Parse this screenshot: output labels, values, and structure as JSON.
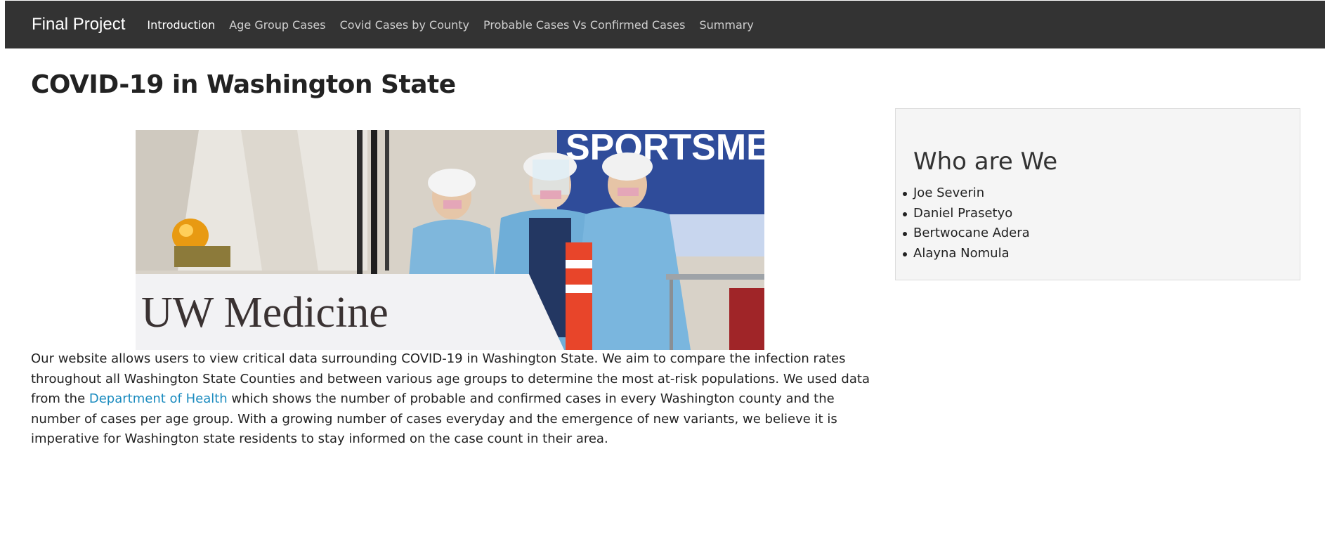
{
  "navbar": {
    "brand": "Final Project",
    "items": [
      {
        "label": "Introduction",
        "active": true
      },
      {
        "label": "Age Group Cases",
        "active": false
      },
      {
        "label": "Covid Cases by County",
        "active": false
      },
      {
        "label": "Probable Cases Vs Confirmed Cases",
        "active": false
      },
      {
        "label": "Summary",
        "active": false
      }
    ]
  },
  "page": {
    "title": "COVID-19 in Washington State"
  },
  "hero": {
    "banner_text": "UW Medicine",
    "backdrop_text": "SPORTSMEDICI"
  },
  "intro": {
    "text_before_link": "Our website allows users to view critical data surrounding COVID-19 in Washington State. We aim to compare the infection rates throughout all Washington State Counties and between various age groups to determine the most at-risk populations. We used data from the ",
    "link_text": "Department of Health",
    "text_after_link": " which shows the number of probable and confirmed cases in every Washington county and the number of cases per age group. With a growing number of cases everyday and the emergence of new variants, we believe it is imperative for Washington state residents to stay informed on the case count in their area."
  },
  "who": {
    "title": "Who are We",
    "members": [
      "Joe Severin",
      "Daniel Prasetyo",
      "Bertwocane Adera",
      "Alayna Nomula"
    ]
  },
  "colors": {
    "navbar_bg": "#333333",
    "link": "#1a8bbf",
    "panel_bg": "#f5f5f5"
  }
}
